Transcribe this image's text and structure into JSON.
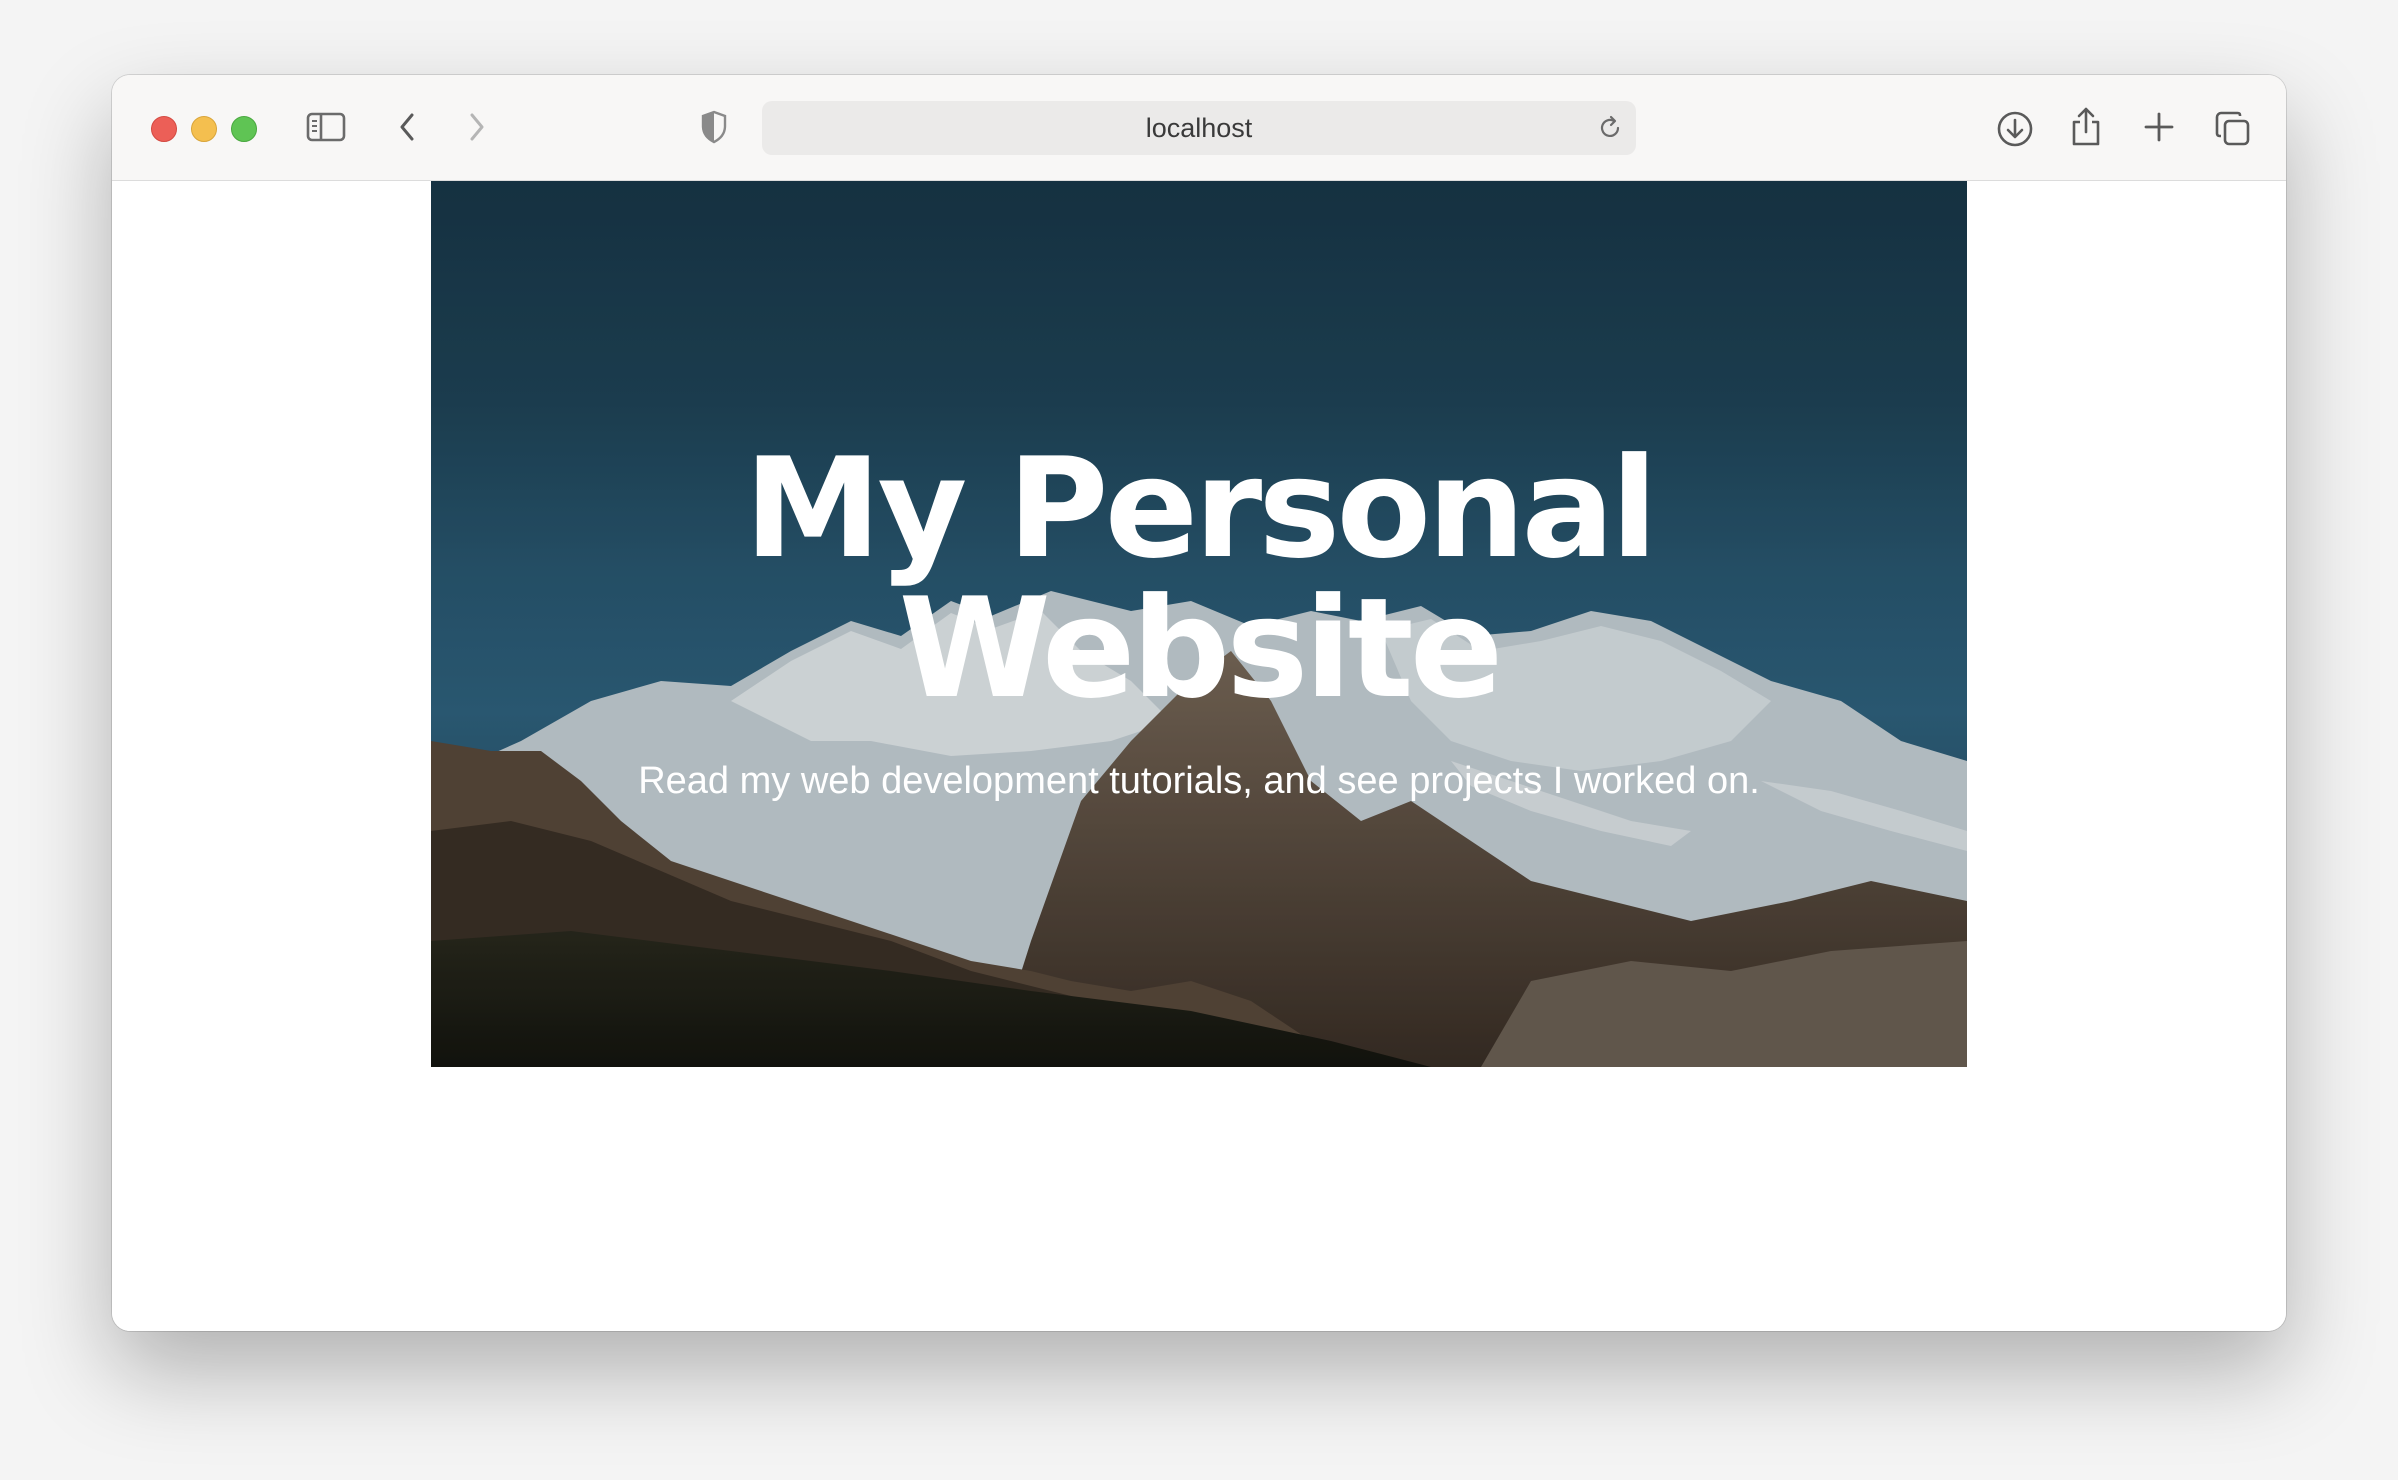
{
  "browser": {
    "url": "localhost",
    "icons": {
      "sidebar": "sidebar-icon",
      "back": "chevron-left-icon",
      "forward": "chevron-right-icon",
      "privacy": "shield-icon",
      "reload": "reload-icon",
      "downloads": "download-icon",
      "share": "share-icon",
      "new_tab": "plus-icon",
      "tabs": "tab-overview-icon"
    }
  },
  "hero": {
    "title_line1": "My Personal",
    "title_line2": "Website",
    "subtitle": "Read my web development tutorials, and see projects I worked on."
  },
  "colors": {
    "close": "#ec5f57",
    "minimize": "#f4bf4f",
    "zoom": "#5fc454",
    "hero_sky": "#1f4559"
  }
}
